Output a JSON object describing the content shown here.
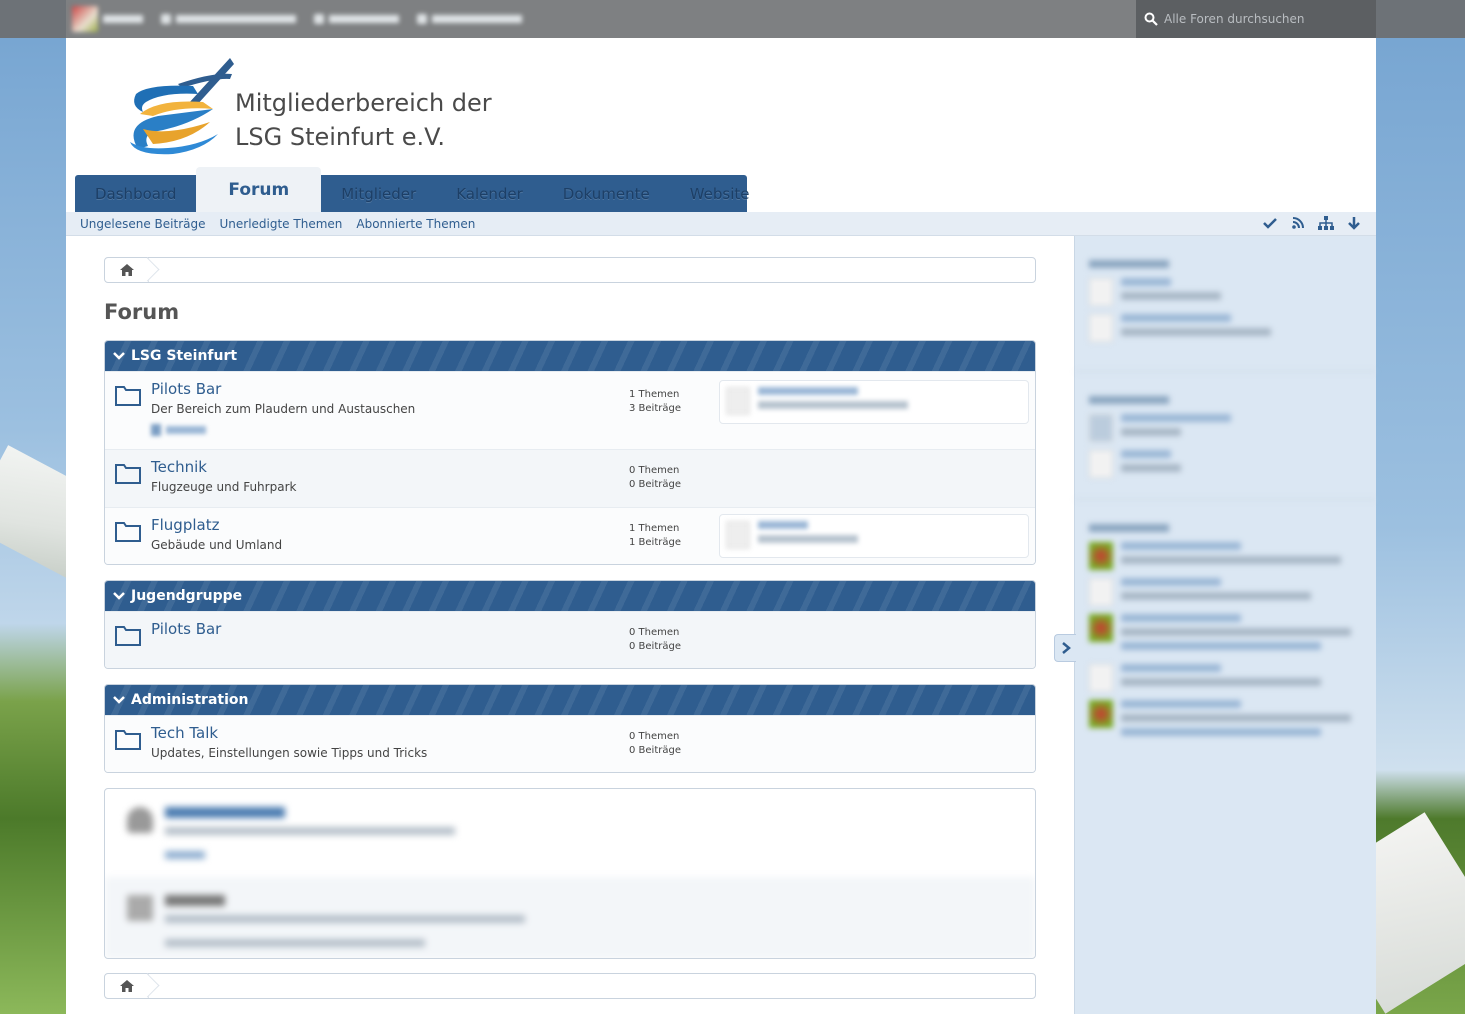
{
  "topbar": {
    "search_placeholder": "Alle Foren durchsuchen"
  },
  "header": {
    "logo_line1": "Mitgliederbereich der",
    "logo_line2": "LSG Steinfurt e.V."
  },
  "mainnav": {
    "tabs": [
      {
        "label": "Dashboard"
      },
      {
        "label": "Forum",
        "active": true
      },
      {
        "label": "Mitglieder"
      },
      {
        "label": "Kalender"
      },
      {
        "label": "Dokumente"
      },
      {
        "label": "Website"
      }
    ]
  },
  "subnav": {
    "links": [
      "Ungelesene Beiträge",
      "Unerledigte Themen",
      "Abonnierte Themen"
    ]
  },
  "main": {
    "title": "Forum",
    "categories": [
      {
        "title": "LSG Steinfurt",
        "boards": [
          {
            "name": "Pilots Bar",
            "desc": "Der Bereich zum Plaudern und Austauschen",
            "threads": "1 Themen",
            "posts": "3 Beiträge"
          },
          {
            "name": "Technik",
            "desc": "Flugzeuge und Fuhrpark",
            "threads": "0 Themen",
            "posts": "0 Beiträge"
          },
          {
            "name": "Flugplatz",
            "desc": "Gebäude und Umland",
            "threads": "1 Themen",
            "posts": "1 Beiträge"
          }
        ]
      },
      {
        "title": "Jugendgruppe",
        "boards": [
          {
            "name": "Pilots Bar",
            "desc": "",
            "threads": "0 Themen",
            "posts": "0 Beiträge"
          }
        ]
      },
      {
        "title": "Administration",
        "boards": [
          {
            "name": "Tech Talk",
            "desc": "Updates, Einstellungen sowie Tipps und Tricks",
            "threads": "0 Themen",
            "posts": "0 Beiträge"
          }
        ]
      }
    ]
  },
  "colors": {
    "brand": "#2f5d8f",
    "sidebar": "#dbe7f3"
  }
}
